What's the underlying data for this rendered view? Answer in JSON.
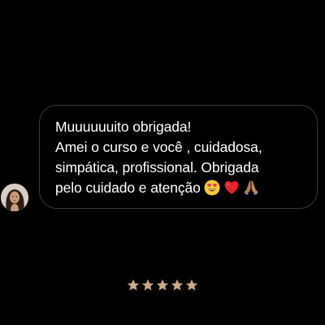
{
  "message": {
    "lines": [
      "Muuuuuuito obrigada!",
      "Amei o curso e você , cuidadosa,",
      "simpática, profissional. Obrigada",
      "pelo cuidado e atenção"
    ],
    "emojis": [
      "heart-eyes-emoji",
      "red-heart-emoji",
      "folded-hands-emoji"
    ]
  },
  "avatar": {
    "icon": "user-avatar-photo"
  },
  "rating": {
    "value": 5,
    "max": 5,
    "star_color": "#c9a98b"
  },
  "colors": {
    "background": "#000000",
    "bubble_border": "#3a3a3a",
    "text": "#ffffff"
  }
}
